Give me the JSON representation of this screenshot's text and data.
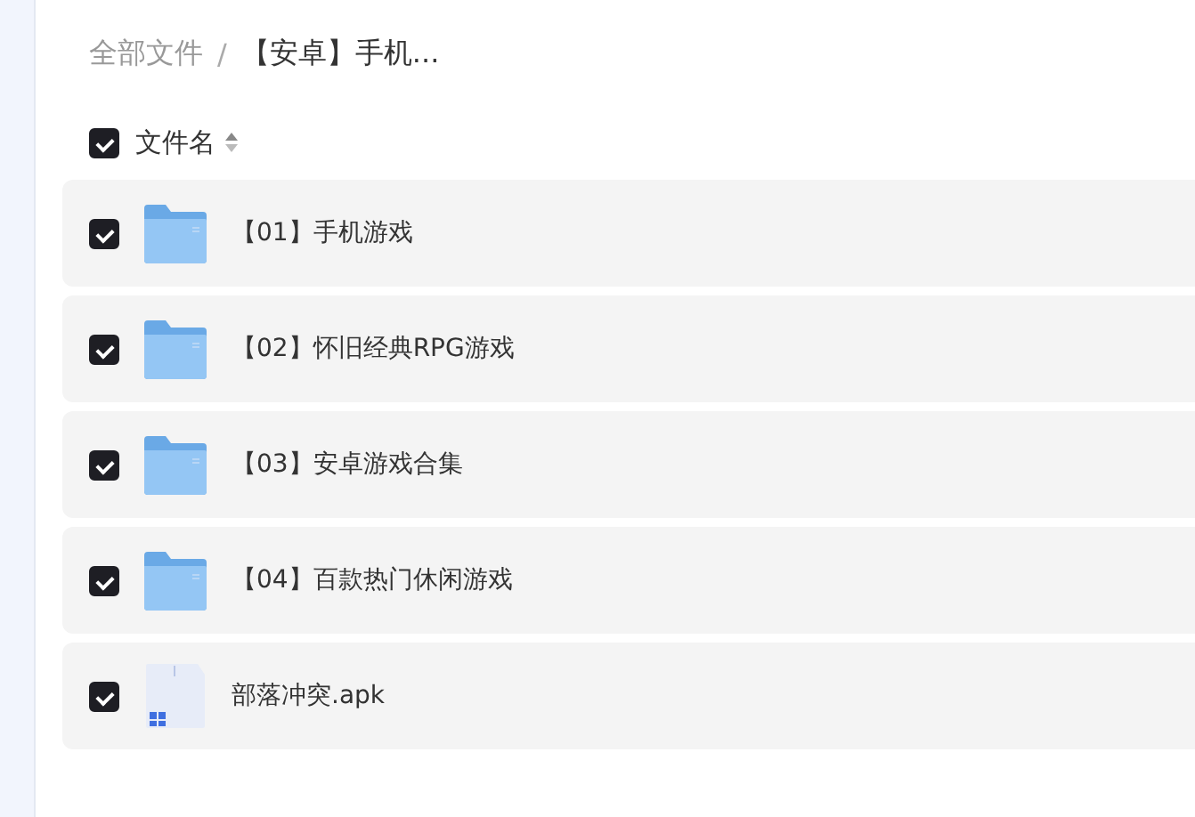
{
  "breadcrumb": {
    "root": "全部文件",
    "separator": "/",
    "current": "【安卓】手机..."
  },
  "header": {
    "checked": true,
    "label": "文件名"
  },
  "files": [
    {
      "name": "【01】手机游戏",
      "kind": "folder",
      "checked": true
    },
    {
      "name": "【02】怀旧经典RPG游戏",
      "kind": "folder",
      "checked": true
    },
    {
      "name": "【03】安卓游戏合集",
      "kind": "folder",
      "checked": true
    },
    {
      "name": "【04】百款热门休闲游戏",
      "kind": "folder",
      "checked": true
    },
    {
      "name": "部落冲突.apk",
      "kind": "apk",
      "checked": true
    }
  ]
}
